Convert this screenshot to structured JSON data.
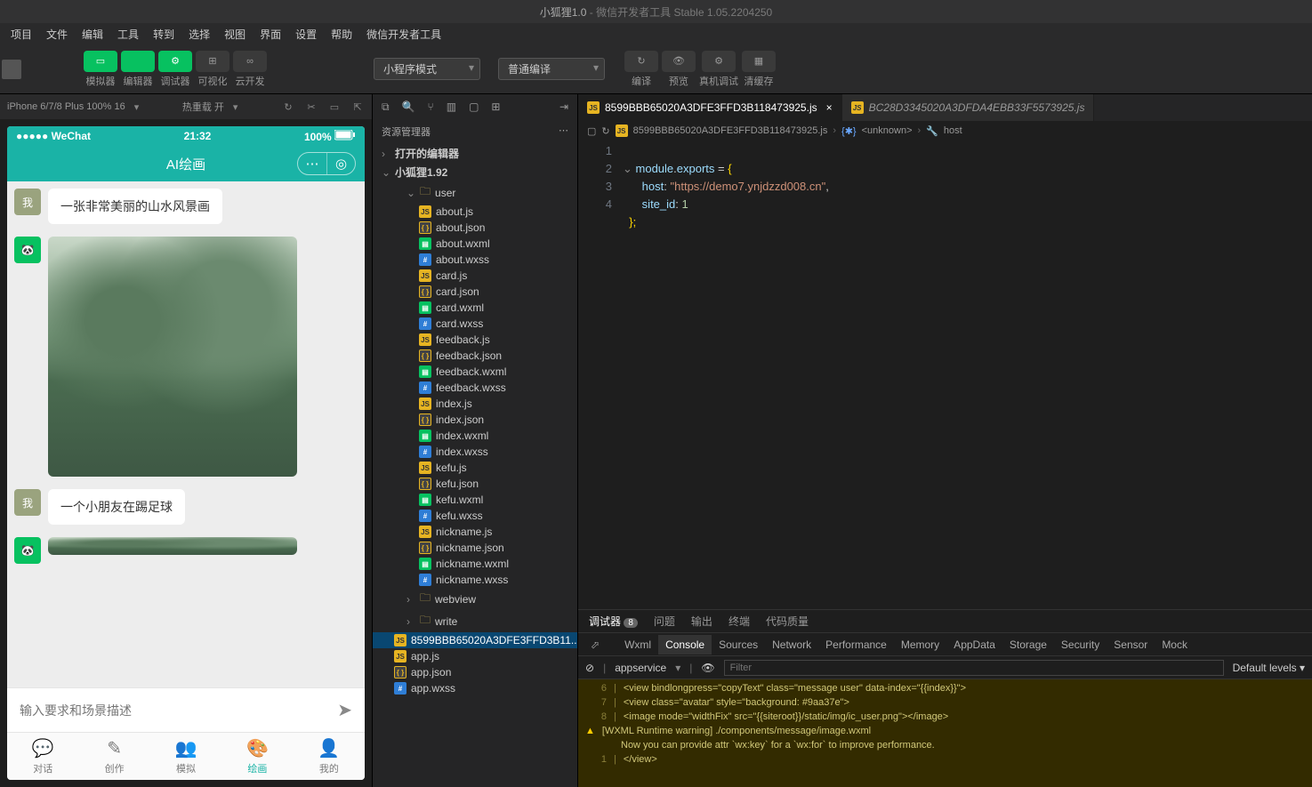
{
  "window": {
    "title_left": "小狐狸1.0",
    "title_right": "微信开发者工具 Stable 1.05.2204250"
  },
  "menu": [
    "项目",
    "文件",
    "编辑",
    "工具",
    "转到",
    "选择",
    "视图",
    "界面",
    "设置",
    "帮助",
    "微信开发者工具"
  ],
  "toolbar": {
    "buttons": [
      {
        "label": "模拟器",
        "type": "green"
      },
      {
        "label": "编辑器",
        "type": "green"
      },
      {
        "label": "调试器",
        "type": "green"
      },
      {
        "label": "可视化",
        "type": "plain"
      },
      {
        "label": "云开发",
        "type": "plain"
      }
    ],
    "mode_select": "小程序模式",
    "compile_select": "普通编译",
    "actions": [
      "编译",
      "预览",
      "真机调试",
      "清缓存"
    ]
  },
  "simulator": {
    "device": "iPhone 6/7/8 Plus 100% 16",
    "hot_reload": "热重载 开",
    "status": {
      "left": "●●●●● WeChat",
      "time": "21:32",
      "right": "100%"
    },
    "header_title": "AI绘画",
    "messages": [
      {
        "avatar": "我",
        "text": "一张非常美丽的山水风景画"
      },
      {
        "avatar": "panda",
        "type": "image"
      },
      {
        "avatar": "我",
        "text": "一个小朋友在踢足球"
      },
      {
        "avatar": "panda",
        "type": "image-partial"
      }
    ],
    "input_placeholder": "输入要求和场景描述",
    "tabs": [
      "对话",
      "创作",
      "模拟",
      "绘画",
      "我的"
    ],
    "tab_active": 3
  },
  "explorer": {
    "title": "资源管理器",
    "sections": [
      {
        "label": "打开的编辑器",
        "expanded": false
      },
      {
        "label": "小狐狸1.92",
        "expanded": true
      }
    ],
    "tree": [
      {
        "indent": 2,
        "type": "folder",
        "open": true,
        "name": "user"
      },
      {
        "indent": 3,
        "type": "js",
        "name": "about.js"
      },
      {
        "indent": 3,
        "type": "json",
        "name": "about.json"
      },
      {
        "indent": 3,
        "type": "wxml",
        "name": "about.wxml"
      },
      {
        "indent": 3,
        "type": "wxss",
        "name": "about.wxss"
      },
      {
        "indent": 3,
        "type": "js",
        "name": "card.js"
      },
      {
        "indent": 3,
        "type": "json",
        "name": "card.json"
      },
      {
        "indent": 3,
        "type": "wxml",
        "name": "card.wxml"
      },
      {
        "indent": 3,
        "type": "wxss",
        "name": "card.wxss"
      },
      {
        "indent": 3,
        "type": "js",
        "name": "feedback.js"
      },
      {
        "indent": 3,
        "type": "json",
        "name": "feedback.json"
      },
      {
        "indent": 3,
        "type": "wxml",
        "name": "feedback.wxml"
      },
      {
        "indent": 3,
        "type": "wxss",
        "name": "feedback.wxss"
      },
      {
        "indent": 3,
        "type": "js",
        "name": "index.js"
      },
      {
        "indent": 3,
        "type": "json",
        "name": "index.json"
      },
      {
        "indent": 3,
        "type": "wxml",
        "name": "index.wxml"
      },
      {
        "indent": 3,
        "type": "wxss",
        "name": "index.wxss"
      },
      {
        "indent": 3,
        "type": "js",
        "name": "kefu.js"
      },
      {
        "indent": 3,
        "type": "json",
        "name": "kefu.json"
      },
      {
        "indent": 3,
        "type": "wxml",
        "name": "kefu.wxml"
      },
      {
        "indent": 3,
        "type": "wxss",
        "name": "kefu.wxss"
      },
      {
        "indent": 3,
        "type": "js",
        "name": "nickname.js"
      },
      {
        "indent": 3,
        "type": "json",
        "name": "nickname.json"
      },
      {
        "indent": 3,
        "type": "wxml",
        "name": "nickname.wxml"
      },
      {
        "indent": 3,
        "type": "wxss",
        "name": "nickname.wxss"
      },
      {
        "indent": 2,
        "type": "folder",
        "open": false,
        "name": "webview"
      },
      {
        "indent": 2,
        "type": "folder",
        "open": false,
        "name": "write"
      },
      {
        "indent": 1,
        "type": "js",
        "name": "8599BBB65020A3DFE3FFD3B11...",
        "hl": true
      },
      {
        "indent": 1,
        "type": "js",
        "name": "app.js"
      },
      {
        "indent": 1,
        "type": "json",
        "name": "app.json"
      },
      {
        "indent": 1,
        "type": "wxss",
        "name": "app.wxss"
      }
    ]
  },
  "editor": {
    "tabs": [
      {
        "name": "8599BBB65020A3DFE3FFD3B118473925.js",
        "active": true
      },
      {
        "name": "BC28D3345020A3DFDA4EBB33F5573925.js",
        "active": false
      }
    ],
    "breadcrumb": [
      "...",
      "8599BBB65020A3DFE3FFD3B118473925.js",
      "<unknown>",
      "host"
    ],
    "code": {
      "l1_a": "module",
      "l1_b": ".",
      "l1_c": "exports",
      "l1_d": " = ",
      "l1_e": "{",
      "l2_a": "    host",
      "l2_b": ": ",
      "l2_c": "\"https://demo7.ynjdzzd008.cn\"",
      "l2_d": ",",
      "l3_a": "    site_id",
      "l3_b": ": ",
      "l3_c": "1",
      "l4": "};"
    }
  },
  "debug": {
    "tabs": [
      {
        "label": "调试器",
        "badge": "8"
      },
      {
        "label": "问题"
      },
      {
        "label": "输出"
      },
      {
        "label": "终端"
      },
      {
        "label": "代码质量"
      }
    ],
    "subtabs": [
      "Wxml",
      "Console",
      "Sources",
      "Network",
      "Performance",
      "Memory",
      "AppData",
      "Storage",
      "Security",
      "Sensor",
      "Mock"
    ],
    "subtab_active": 1,
    "filter": {
      "context": "appservice",
      "levels": "Default levels ▾",
      "placeholder": "Filter"
    },
    "console": [
      {
        "ln": "6",
        "t": "        <view bindlongpress=\"copyText\" class=\"message user\" data-index=\"{{index}}\">"
      },
      {
        "ln": "7",
        "t": "          <view class=\"avatar\" style=\"background: #9aa37e\">"
      },
      {
        "ln": "8",
        "t": "            <image mode=\"widthFix\" src=\"{{siteroot}}/static/img/ic_user.png\"></image>"
      },
      {
        "warn": true,
        "t": "[WXML Runtime warning] ./components/message/image.wxml"
      },
      {
        "t": "Now you can provide attr `wx:key` for a `wx:for` to improve performance."
      },
      {
        "ln": "1",
        "t": "      </view>"
      }
    ]
  }
}
